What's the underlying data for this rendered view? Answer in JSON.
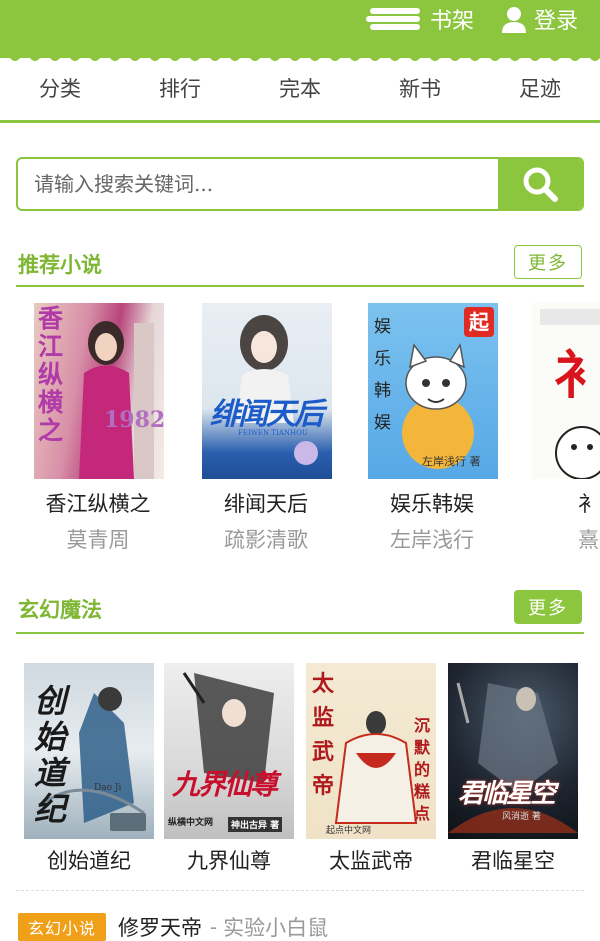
{
  "header": {
    "bookshelf_label": "书架",
    "login_label": "登录",
    "bookshelf_icon": "bookshelf-icon",
    "user_icon": "user-icon",
    "accent_color": "#8cc63f"
  },
  "nav": {
    "tabs": [
      {
        "label": "分类"
      },
      {
        "label": "排行"
      },
      {
        "label": "完本"
      },
      {
        "label": "新书"
      },
      {
        "label": "足迹"
      }
    ]
  },
  "search": {
    "placeholder": "请输入搜索关键词...",
    "value": "",
    "icon": "search-icon"
  },
  "recommended": {
    "title": "推荐小说",
    "more_label": "更多",
    "books": [
      {
        "title": "香江纵横之",
        "author": "莫青周",
        "cover_text": "香江纵横之",
        "cover_num": "1982"
      },
      {
        "title": "绯闻天后",
        "author": "疏影清歌",
        "cover_text": "绯闻天后",
        "cover_sub": "FEIWEN TIANHOU"
      },
      {
        "title": "娱乐韩娱",
        "author": "左岸浅行",
        "cover_text": "娱乐韩娱",
        "cover_badge": "起",
        "cover_author": "左岸浅行 著"
      },
      {
        "title": "衤",
        "author": "熹",
        "cover_text": "衤"
      }
    ]
  },
  "fantasy": {
    "title": "玄幻魔法",
    "more_label": "更多",
    "books": [
      {
        "title": "创始道纪",
        "cover_text": "创始道纪",
        "cover_sub": "Dao Ji"
      },
      {
        "title": "九界仙尊",
        "cover_text": "九界仙尊",
        "cover_brand": "纵横中文网",
        "cover_author": "神出古异 著"
      },
      {
        "title": "太监武帝",
        "cover_text": "太监武帝",
        "cover_side": "沉默的糕点",
        "cover_brand": "起点中文网"
      },
      {
        "title": "君临星空",
        "cover_text": "君临星空",
        "cover_author": "风消逝 著"
      }
    ]
  },
  "list": {
    "items": [
      {
        "badge": "玄幻小说",
        "title": "修罗天帝",
        "separator": "-",
        "author": "实验小白鼠"
      }
    ]
  }
}
